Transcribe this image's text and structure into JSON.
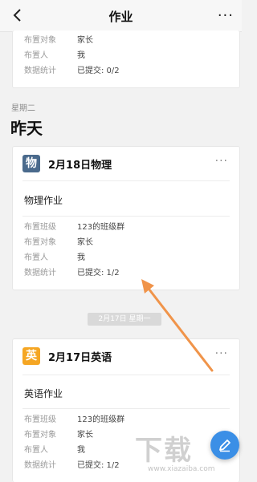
{
  "header": {
    "title": "作业",
    "more": "···"
  },
  "card_top": {
    "rows": [
      {
        "k": "布置对象",
        "v": "家长"
      },
      {
        "k": "布置人",
        "v": "我"
      },
      {
        "k": "数据统计",
        "v": "已提交: 0/2"
      }
    ]
  },
  "section": {
    "weekday": "星期二",
    "label": "昨天"
  },
  "card_physics": {
    "subject_char": "物",
    "title": "2月18日物理",
    "more": "···",
    "homework": "物理作业",
    "rows": [
      {
        "k": "布置班级",
        "v": "123的班级群"
      },
      {
        "k": "布置对象",
        "v": "家长"
      },
      {
        "k": "布置人",
        "v": "我"
      },
      {
        "k": "数据统计",
        "v": "已提交: 1/2"
      }
    ]
  },
  "date_pill": "2月17日 星期一",
  "card_english": {
    "subject_char": "英",
    "title": "2月17日英语",
    "more": "···",
    "homework": "英语作业",
    "rows": [
      {
        "k": "布置班级",
        "v": "123的班级群"
      },
      {
        "k": "布置对象",
        "v": "家长"
      },
      {
        "k": "布置人",
        "v": "我"
      },
      {
        "k": "数据统计",
        "v": "已提交: 1/2"
      }
    ]
  },
  "watermark": {
    "text": "下载",
    "url": "www.xiazaiba.com"
  },
  "colors": {
    "physics": "#4a6a8c",
    "english": "#f5a623",
    "fab": "#3b8fe6",
    "arrow": "#f0944a"
  },
  "icons": {
    "back": "chevron-left-icon",
    "fab": "pencil-icon"
  }
}
